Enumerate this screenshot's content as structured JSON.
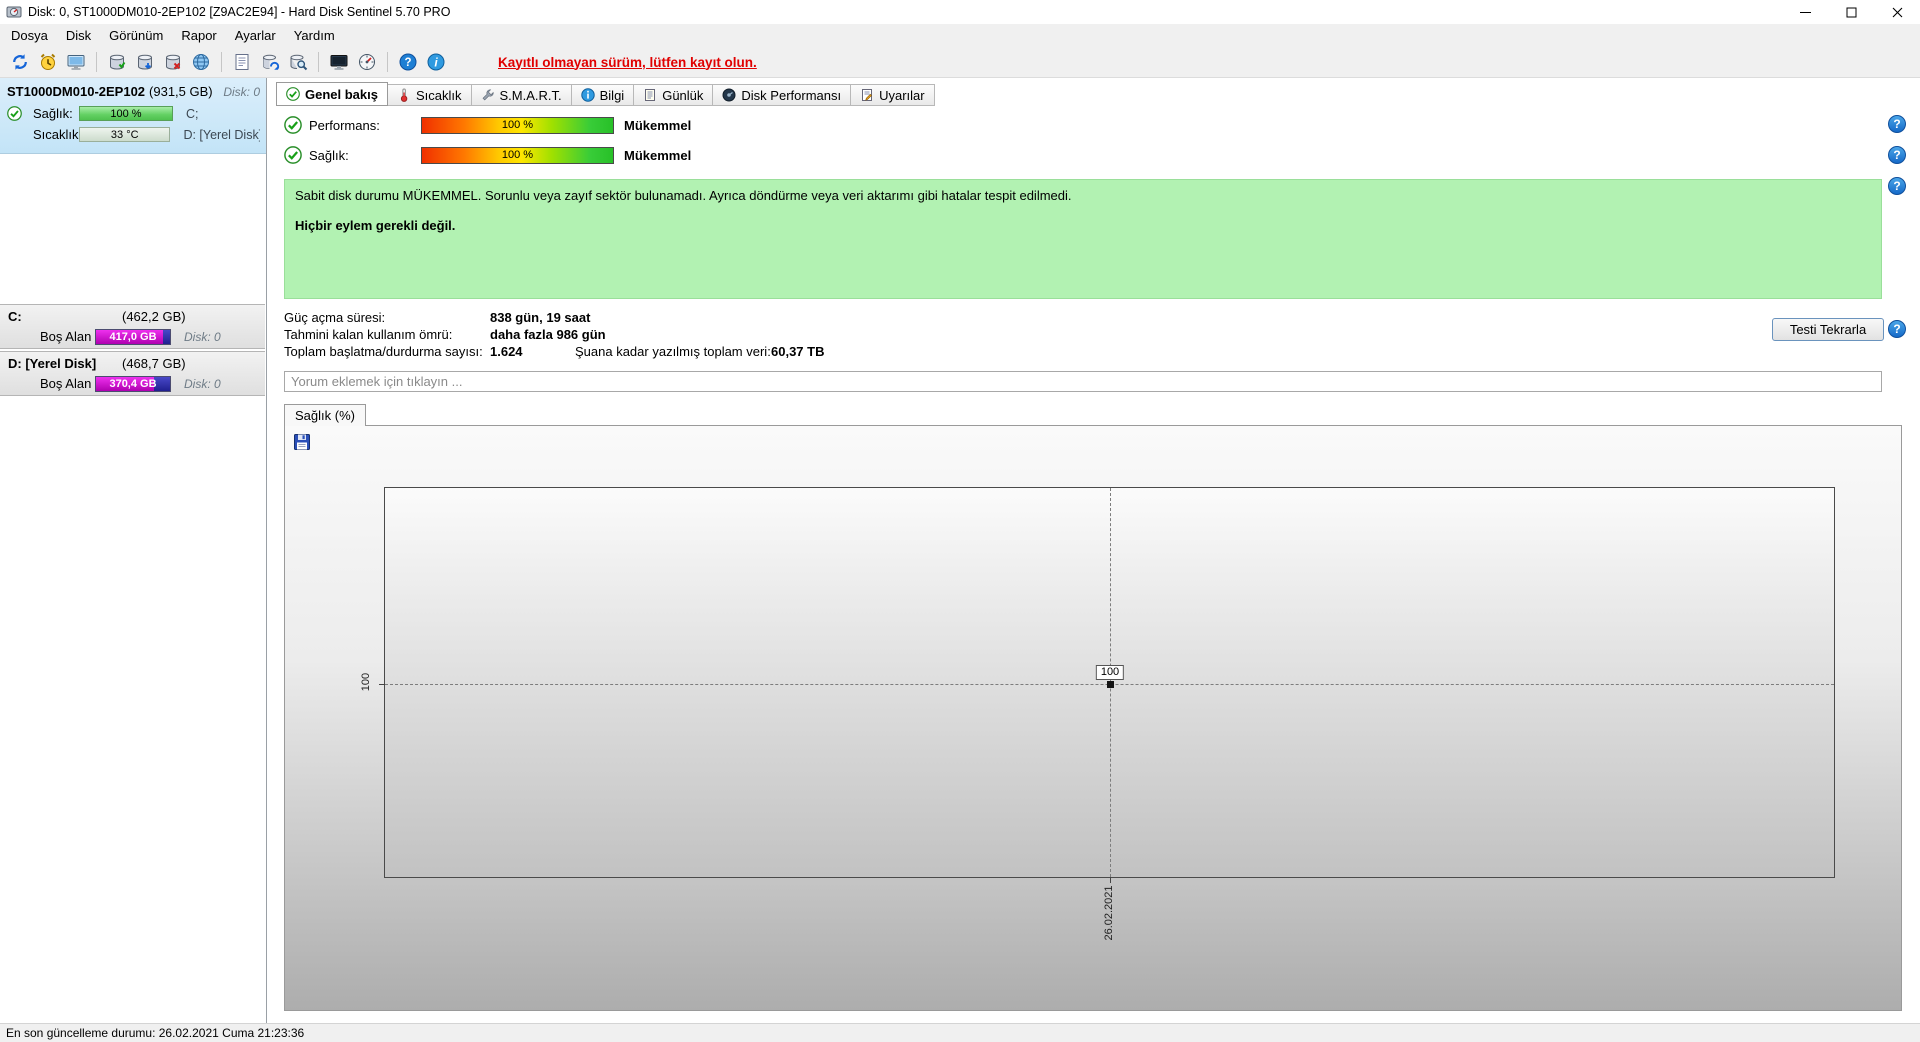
{
  "window": {
    "title": "Disk: 0, ST1000DM010-2EP102 [Z9AC2E94]  -  Hard Disk Sentinel 5.70 PRO"
  },
  "menu_bar": {
    "items": [
      {
        "label": "Dosya"
      },
      {
        "label": "Disk"
      },
      {
        "label": "Görünüm"
      },
      {
        "label": "Rapor"
      },
      {
        "label": "Ayarlar"
      },
      {
        "label": "Yardım"
      }
    ]
  },
  "toolbar": {
    "register_link": "Kayıtlı olmayan sürüm, lütfen kayıt olun."
  },
  "icons": {
    "help_glyph": "?",
    "info_glyph": "i"
  },
  "sidebar": {
    "disk": {
      "model": "ST1000DM010-2EP102",
      "capacity": "(931,5 GB)",
      "disk_no": "Disk: 0",
      "health_label": "Sağlık:",
      "health_value": "100 %",
      "temp_label": "Sıcaklık:",
      "temp_value": "33 °C",
      "partition_c": "C;",
      "partition_d": "D: [Yerel Disk]"
    },
    "partitions": [
      {
        "name": "C:",
        "capacity": "(462,2 GB)",
        "free_label": "Boş Alan",
        "free_value": "417,0 GB",
        "disk_no": "Disk: 0",
        "free_width": "90%"
      },
      {
        "name": "D: [Yerel Disk]",
        "capacity": "(468,7 GB)",
        "free_label": "Boş Alan",
        "free_value": "370,4 GB",
        "disk_no": "Disk: 0",
        "free_width": "79%"
      }
    ]
  },
  "tabs": [
    {
      "label": "Genel bakış",
      "active": true
    },
    {
      "label": "Sıcaklık",
      "active": false
    },
    {
      "label": "S.M.A.R.T.",
      "active": false
    },
    {
      "label": "Bilgi",
      "active": false
    },
    {
      "label": "Günlük",
      "active": false
    },
    {
      "label": "Disk Performansı",
      "active": false
    },
    {
      "label": "Uyarılar",
      "active": false
    }
  ],
  "overview": {
    "performance": {
      "label": "Performans:",
      "value": "100 %",
      "rating": "Mükemmel"
    },
    "health": {
      "label": "Sağlık:",
      "value": "100 %",
      "rating": "Mükemmel"
    },
    "status_text": "Sabit disk durumu MÜKEMMEL. Sorunlu veya zayıf sektör bulunamadı. Ayrıca döndürme veya veri aktarımı gibi hatalar tespit edilmedi.",
    "action_text": "Hiçbir eylem gerekli değil.",
    "stats": [
      {
        "label": "Güç açma süresi:",
        "value": "838 gün, 19 saat"
      },
      {
        "label": "Tahmini kalan kullanım ömrü:",
        "value": "daha fazla 986 gün"
      },
      {
        "label": "Toplam başlatma/durdurma sayısı:",
        "value": "1.624"
      },
      {
        "label": "Şuana kadar yazılmış toplam veri:",
        "value": "60,37 TB"
      }
    ],
    "retest_button": "Testi Tekrarla",
    "comment_placeholder": "Yorum eklemek için tıklayın ..."
  },
  "chart": {
    "tab_label": "Sağlık (%)",
    "chart_data": {
      "type": "line",
      "title": "Sağlık (%)",
      "x": [
        "26.02.2021"
      ],
      "values": [
        100
      ],
      "y_ticks": [
        "100"
      ],
      "point_label": "100",
      "ylim": [
        0,
        200
      ],
      "grid": "dashed"
    }
  },
  "status_bar": {
    "text": "En son güncelleme durumu: 26.02.2021 Cuma 21:23:36"
  }
}
